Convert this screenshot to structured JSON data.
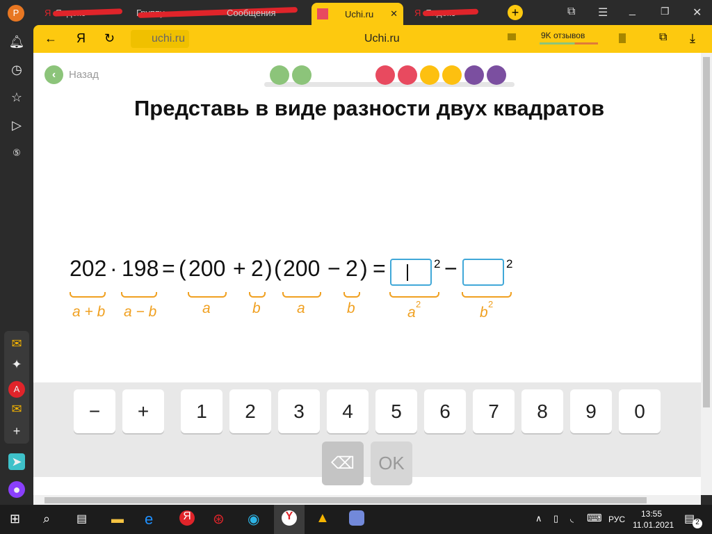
{
  "browser": {
    "profile_initial": "P",
    "tabs": [
      {
        "label": "Яндекс"
      },
      {
        "label": "Группу"
      },
      {
        "label": "Сообщения"
      },
      {
        "label": "Uchi.ru"
      },
      {
        "label": "Яндекс"
      }
    ],
    "address": "uchi.ru",
    "page_title": "Uchi.ru",
    "reviews": "9K отзывов"
  },
  "page": {
    "back": "Назад",
    "title": "Представь в виде разности двух квадратов",
    "progress_colors": [
      "#8cc47a",
      "#8cc47a",
      "#e84a5f",
      "#e84a5f",
      "#fdc010",
      "#fdc010",
      "#7b4fa0",
      "#7b4fa0"
    ],
    "equation": {
      "t1": "202",
      "dot": "·",
      "t2": "198",
      "eq": "=",
      "lp1": "(",
      "a1": "200",
      "plus": "+",
      "b1": "2",
      "rp1": ")",
      "lp2": "(",
      "a2": "200",
      "minus": "−",
      "b2": "2",
      "rp2": ")",
      "eq2": "=",
      "sq": "2",
      "minus2": "−",
      "sq2": "2"
    },
    "labels": {
      "apb": "a + b",
      "amb": "a − b",
      "a": "a",
      "b": "b",
      "a2": "a",
      "b2": "b",
      "asq": "a",
      "bsq": "b",
      "exp": "2"
    },
    "keys": [
      "−",
      "+",
      "1",
      "2",
      "3",
      "4",
      "5",
      "6",
      "7",
      "8",
      "9",
      "0"
    ],
    "ok": "OK"
  },
  "taskbar": {
    "lang": "РУС",
    "time": "13:55",
    "date": "11.01.2021",
    "notifications": "2"
  }
}
